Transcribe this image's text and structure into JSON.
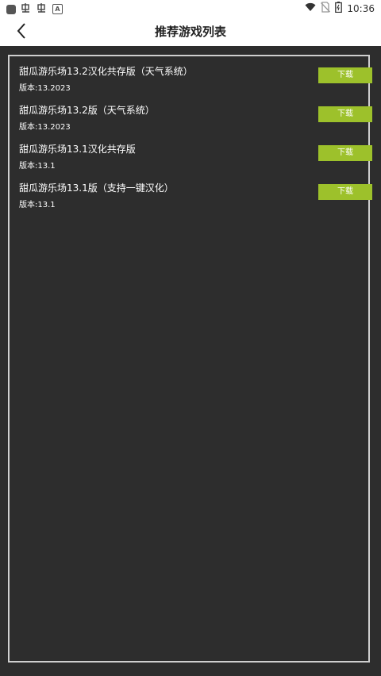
{
  "status_bar": {
    "time": "10:36",
    "icons": [
      "app-square-icon",
      "notification-glyph-icon",
      "notification-glyph-icon",
      "a-box-icon",
      "wifi-icon",
      "no-sim-icon",
      "battery-icon"
    ]
  },
  "header": {
    "title": "推荐游戏列表",
    "back_icon": "chevron-left-icon"
  },
  "games": [
    {
      "name": "甜瓜游乐场13.2汉化共存版（天气系统）",
      "version": "版本:13.2023",
      "download_label": "下载"
    },
    {
      "name": "甜瓜游乐场13.2版（天气系统）",
      "version": "版本:13.2023",
      "download_label": "下载"
    },
    {
      "name": "甜瓜游乐场13.1汉化共存版",
      "version": "版本:13.1",
      "download_label": "下载"
    },
    {
      "name": "甜瓜游乐场13.1版（支持一键汉化）",
      "version": "版本:13.1",
      "download_label": "下载"
    }
  ],
  "colors": {
    "background": "#2d2d2d",
    "accent": "#9dc12b",
    "frame_border": "#cfcfcf"
  }
}
